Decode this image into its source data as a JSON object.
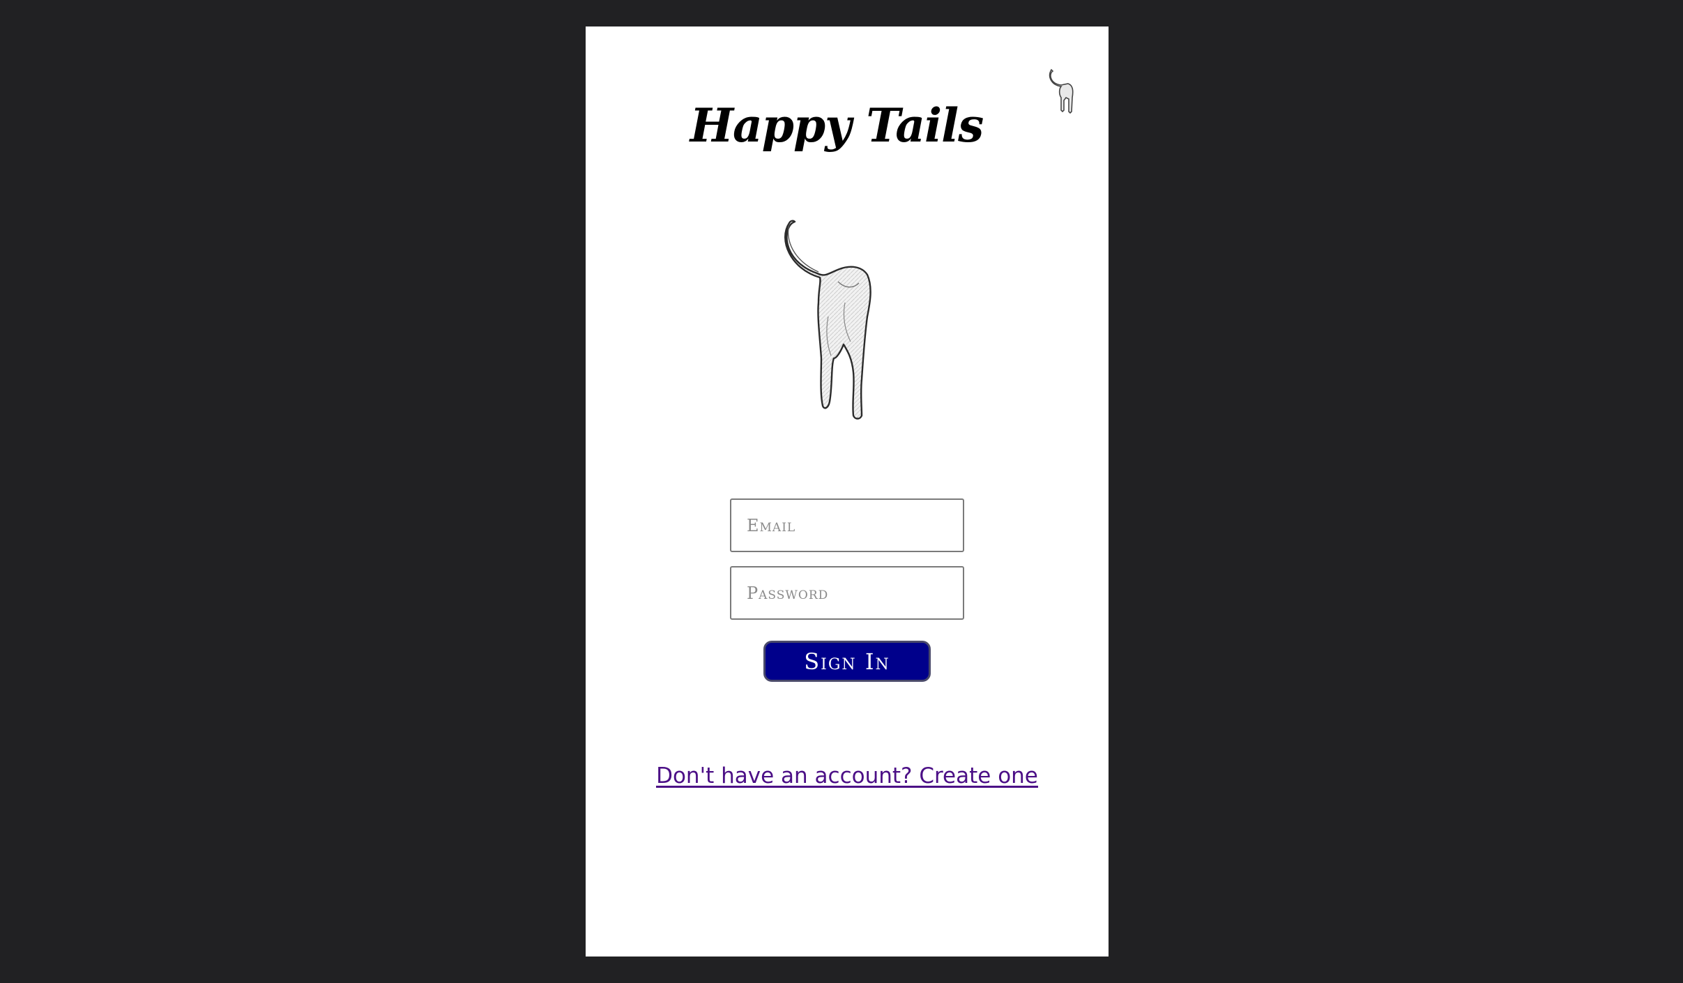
{
  "app": {
    "title": "Happy Tails"
  },
  "header": {
    "logo_icon": "dog-tail-icon"
  },
  "hero": {
    "image_icon": "dog-tail-illustration"
  },
  "form": {
    "email_placeholder": "Email",
    "email_value": "",
    "password_placeholder": "Password",
    "password_value": "",
    "signin_label": "Sign In"
  },
  "footer": {
    "create_account_label": "Don't have an account? Create one"
  },
  "colors": {
    "background": "#212123",
    "card": "#ffffff",
    "button": "#00008b",
    "link": "#4b0f86"
  }
}
